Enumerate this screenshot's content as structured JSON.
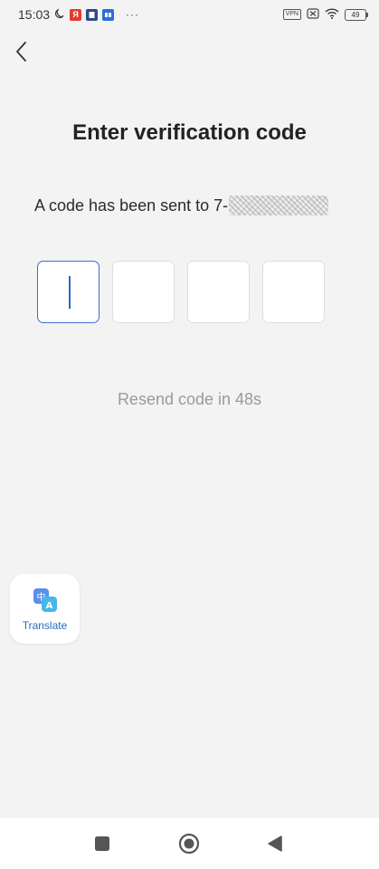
{
  "status_bar": {
    "time": "15:03",
    "app_badges": [
      "Я",
      "",
      ""
    ],
    "more": "···",
    "vpn": "VPN",
    "battery": "49"
  },
  "header": {
    "back_icon": "chevron-left-icon"
  },
  "main": {
    "title": "Enter verification code",
    "sent_prefix": "A code has been sent to 7-",
    "code_boxes": [
      "",
      "",
      "",
      ""
    ],
    "resend_text": "Resend code in 48s"
  },
  "translate_widget": {
    "label": "Translate",
    "icon": "translate-icon"
  },
  "nav_bar": {
    "recents_icon": "square-icon",
    "home_icon": "circle-icon",
    "back_icon": "triangle-back-icon"
  },
  "colors": {
    "accent": "#3d6fd1",
    "background": "#f3f3f3",
    "muted_text": "#9a9a9a"
  }
}
